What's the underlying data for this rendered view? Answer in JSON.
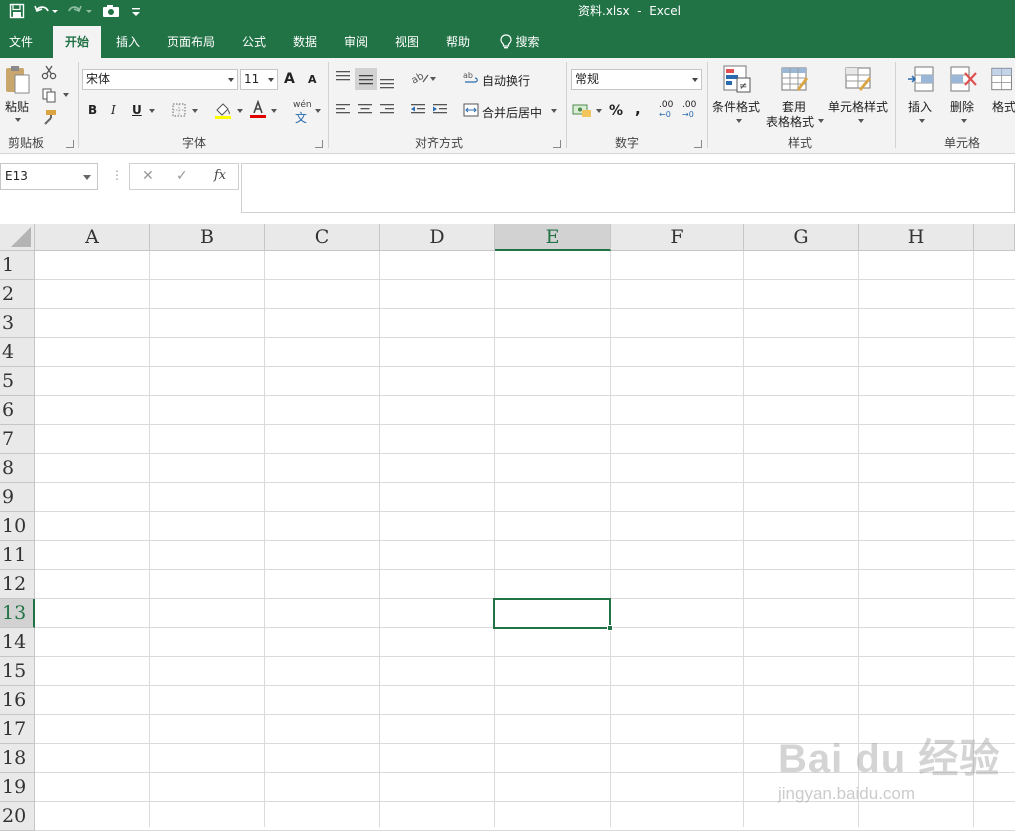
{
  "window": {
    "title": "资料.xlsx  -  Excel"
  },
  "quick_access": [
    {
      "name": "save-icon"
    },
    {
      "name": "undo-icon"
    },
    {
      "name": "redo-icon"
    },
    {
      "name": "camera-icon"
    },
    {
      "name": "customize-qat-icon"
    }
  ],
  "tabs": [
    {
      "label": "文件",
      "active": false
    },
    {
      "label": "开始",
      "active": true
    },
    {
      "label": "插入",
      "active": false
    },
    {
      "label": "页面布局",
      "active": false
    },
    {
      "label": "公式",
      "active": false
    },
    {
      "label": "数据",
      "active": false
    },
    {
      "label": "审阅",
      "active": false
    },
    {
      "label": "视图",
      "active": false
    },
    {
      "label": "帮助",
      "active": false
    }
  ],
  "search": {
    "label": "搜索",
    "icon": "lightbulb-icon"
  },
  "ribbon": {
    "clipboard": {
      "group_label": "剪贴板",
      "paste_label": "粘贴"
    },
    "font": {
      "group_label": "字体",
      "font_name": "宋体",
      "font_size": "11",
      "bold": "B",
      "italic": "I",
      "underline": "U",
      "grow": "A",
      "shrink": "A",
      "phonetic": "wén"
    },
    "alignment": {
      "group_label": "对齐方式",
      "wrap_text": "自动换行",
      "merge_center": "合并后居中"
    },
    "number": {
      "group_label": "数字",
      "format": "常规",
      "percent": "%",
      "comma": ",",
      "inc_decimal": ".00",
      "dec_decimal": ".00"
    },
    "styles": {
      "group_label": "样式",
      "conditional_formatting": "条件格式",
      "format_as_table_line1": "套用",
      "format_as_table_line2": "表格格式",
      "cell_styles": "单元格样式"
    },
    "cells": {
      "group_label": "单元格",
      "insert": "插入",
      "delete": "删除",
      "format": "格式"
    }
  },
  "formula_bar": {
    "name_box": "E13",
    "cancel": "✕",
    "enter": "✓",
    "fx": "fx",
    "value": ""
  },
  "sheet": {
    "columns": [
      "A",
      "B",
      "C",
      "D",
      "E",
      "F",
      "G",
      "H"
    ],
    "rows": [
      "1",
      "2",
      "3",
      "4",
      "5",
      "6",
      "7",
      "8",
      "9",
      "10",
      "11",
      "12",
      "13",
      "14",
      "15",
      "16",
      "17",
      "18",
      "19",
      "20"
    ],
    "selected_column": "E",
    "selected_row": "13",
    "accent_color": "#217346"
  },
  "watermark": {
    "brand": "Bai du 经验",
    "url": "jingyan.baidu.com"
  }
}
